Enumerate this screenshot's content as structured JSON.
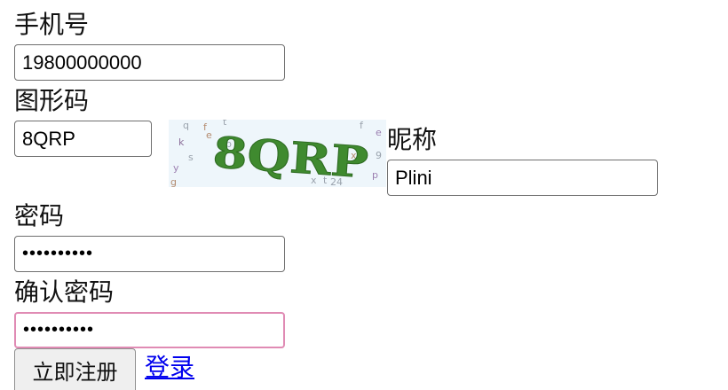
{
  "form": {
    "phone": {
      "label": "手机号",
      "value": "19800000000"
    },
    "captcha": {
      "label": "图形码",
      "value": "8QRP",
      "image_text": "8QRP"
    },
    "nickname": {
      "label": "昵称",
      "value": "Plini"
    },
    "password": {
      "label": "密码",
      "value": "••••••••••"
    },
    "confirm_password": {
      "label": "确认密码",
      "value": "••••••••••"
    },
    "submit_label": "立即注册",
    "login_link": "登录"
  },
  "colors": {
    "focus_border": "#e08bb4",
    "link": "#0000ee",
    "captcha_text": "#3f8a2f",
    "captcha_bg": "#eef6fb"
  }
}
